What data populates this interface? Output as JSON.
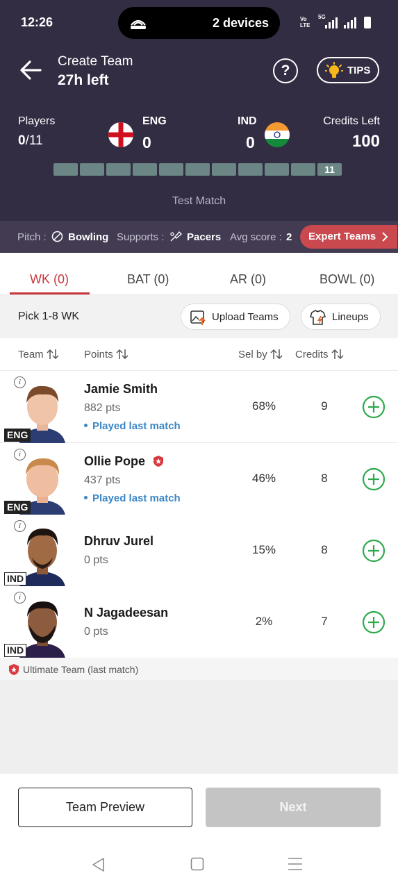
{
  "status_bar": {
    "time": "12:26",
    "devices": "2 devices",
    "volte": "Vo\nLTE",
    "network": "5G"
  },
  "header": {
    "title": "Create Team",
    "time_left": "27h left",
    "help": "?",
    "tips": "TIPS"
  },
  "summary": {
    "players_label": "Players",
    "players_selected": "0",
    "players_total": "/11",
    "team1": {
      "code": "ENG",
      "count": "0"
    },
    "team2": {
      "code": "IND",
      "count": "0"
    },
    "credits_label": "Credits Left",
    "credits_value": "100",
    "progress": {
      "filled": 0,
      "total": 11,
      "last_label": "11"
    },
    "match_type": "Test Match"
  },
  "pitch": {
    "pitch_label": "Pitch :",
    "pitch_value": "Bowling",
    "supports_label": "Supports :",
    "supports_value": "Pacers",
    "avg_label": "Avg score :",
    "avg_value": "2",
    "expert_button": "Expert Teams"
  },
  "tabs": [
    {
      "label": "WK (0)",
      "active": true
    },
    {
      "label": "BAT (0)",
      "active": false
    },
    {
      "label": "AR (0)",
      "active": false
    },
    {
      "label": "BOWL (0)",
      "active": false
    }
  ],
  "pick": {
    "text": "Pick 1-8 WK",
    "upload_label": "Upload Teams",
    "lineups_label": "Lineups"
  },
  "columns": {
    "team": "Team",
    "points": "Points",
    "sel_by": "Sel by",
    "credits": "Credits"
  },
  "players": [
    {
      "name": "Jamie Smith",
      "points": "882 pts",
      "played": "Played last match",
      "team": "ENG",
      "sel_by": "68%",
      "credits": "9",
      "ultimate": false
    },
    {
      "name": "Ollie Pope",
      "points": "437 pts",
      "played": "Played last match",
      "team": "ENG",
      "sel_by": "46%",
      "credits": "8",
      "ultimate": true
    },
    {
      "name": "Dhruv Jurel",
      "points": "0 pts",
      "played": "",
      "team": "IND",
      "sel_by": "15%",
      "credits": "8",
      "ultimate": false
    },
    {
      "name": "N Jagadeesan",
      "points": "0 pts",
      "played": "",
      "team": "IND",
      "sel_by": "2%",
      "credits": "7",
      "ultimate": false
    }
  ],
  "legend": {
    "text": "Ultimate Team (last match)"
  },
  "footer": {
    "preview_label": "Team Preview",
    "next_label": "Next"
  },
  "colors": {
    "header_bg": "#332d44",
    "accent_red": "#c9353d",
    "add_green": "#2ca94b",
    "played_blue": "#3a87c6"
  }
}
